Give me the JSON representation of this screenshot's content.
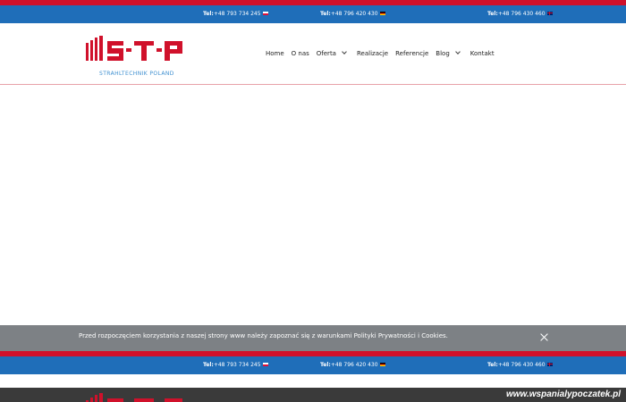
{
  "contact_bar": {
    "phones": [
      {
        "label": "Tel:",
        "number": "+48 793 734 245",
        "flag": "flag-pl-icon"
      },
      {
        "label": "Tel:",
        "number": "+48 796 420 430",
        "flag": "flag-de-icon"
      },
      {
        "label": "Tel:",
        "number": "+48 796 430 460",
        "flag": "flag-gb-icon"
      }
    ]
  },
  "brand": {
    "logo_text": "STP",
    "tagline": "STRAHLTECHNIK POLAND",
    "colors": {
      "logo_red": "#d0112b",
      "tagline_blue": "#3e8fd0"
    }
  },
  "nav": {
    "items": [
      {
        "label": "Home",
        "has_dropdown": false
      },
      {
        "label": "O nas",
        "has_dropdown": false
      },
      {
        "label": "Oferta",
        "has_dropdown": true
      },
      {
        "label": "Realizacje",
        "has_dropdown": false
      },
      {
        "label": "Referencje",
        "has_dropdown": false
      },
      {
        "label": "Blog",
        "has_dropdown": true
      },
      {
        "label": "Kontakt",
        "has_dropdown": false
      }
    ]
  },
  "cookie_notice": {
    "text": "Przed rozpoczęciem korzystania z naszej strony www należy zapoznać się z warunkami Polityki Prywatności i Cookies.",
    "close_icon": "close-icon"
  },
  "watermark": {
    "text": "www.wspanialypoczatek.pl"
  },
  "colors": {
    "bar_blue": "#1f6eb9",
    "bar_red": "#d0112b",
    "cookie_gray": "#7d8185"
  }
}
